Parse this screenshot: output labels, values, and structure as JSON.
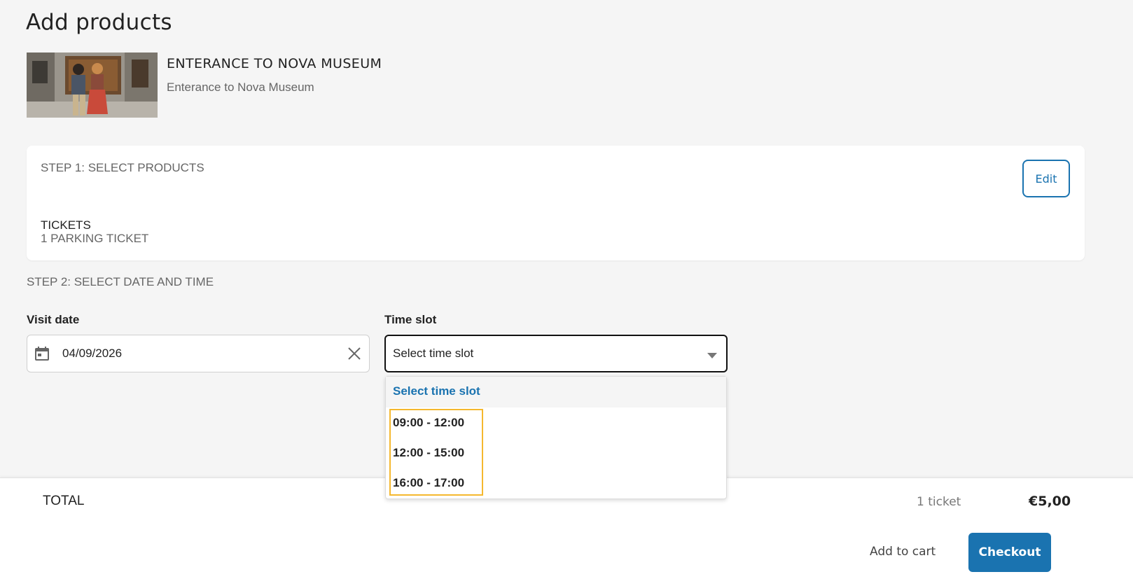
{
  "page": {
    "title": "Add products"
  },
  "product": {
    "name": "ENTERANCE TO NOVA MUSEUM",
    "subtitle": "Enterance to Nova Museum"
  },
  "step1": {
    "title": "STEP 1: SELECT PRODUCTS",
    "edit_label": "Edit",
    "tickets_label": "TICKETS",
    "tickets_value": "1 PARKING TICKET"
  },
  "step2": {
    "title": "STEP 2: SELECT DATE AND TIME",
    "visit_date_label": "Visit date",
    "visit_date_value": "04/09/2026",
    "time_slot_label": "Time slot",
    "time_slot_value": "Select time slot"
  },
  "dropdown": {
    "header": "Select time slot",
    "options": [
      "09:00 - 12:00",
      "12:00 - 15:00",
      "16:00 - 17:00"
    ]
  },
  "footer": {
    "total_label": "TOTAL",
    "ticket_count": "1 ticket",
    "total_price": "€5,00",
    "add_to_cart_label": "Add to cart",
    "checkout_label": "Checkout"
  },
  "colors": {
    "accent": "#1a73b0",
    "highlight": "#f5b82e",
    "background": "#f5f5f5"
  },
  "icons": {
    "calendar": "calendar-icon",
    "clear": "close-icon",
    "caret": "chevron-down-icon"
  }
}
